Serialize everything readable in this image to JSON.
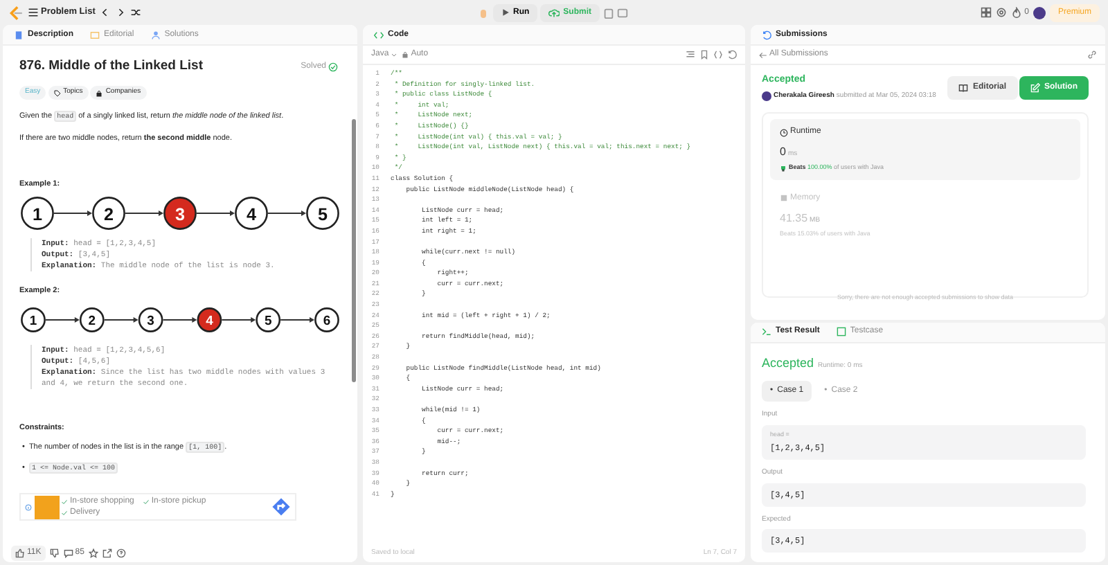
{
  "topbar": {
    "nav_label": "Problem List",
    "run_label": "Run",
    "submit_label": "Submit",
    "streak": "0",
    "premium": "Premium"
  },
  "description": {
    "tabs": [
      {
        "label": "Description",
        "selected": true
      },
      {
        "label": "Editorial",
        "selected": false
      },
      {
        "label": "Solutions",
        "selected": false
      }
    ],
    "title": "876. Middle of the Linked List",
    "status": "Solved",
    "tags": [
      {
        "label": "Easy",
        "kind": "difficulty"
      },
      {
        "label": "Topics",
        "kind": "topics"
      },
      {
        "label": "Companies",
        "kind": "companies"
      }
    ],
    "paragraphs": [
      [
        {
          "text": "Given the ",
          "kind": "text"
        },
        {
          "text": "head",
          "kind": "code"
        },
        {
          "text": " of a singly linked list, return ",
          "kind": "text"
        },
        {
          "text": "the middle node of the linked list",
          "kind": "italic"
        },
        {
          "text": ".",
          "kind": "text"
        }
      ],
      [
        {
          "text": "If there are two middle nodes, return ",
          "kind": "text"
        },
        {
          "text": "the second middle",
          "kind": "bold"
        },
        {
          "text": " node.",
          "kind": "text"
        }
      ]
    ],
    "examples": [
      {
        "title": "Example 1:",
        "nodes": [
          {
            "value": "1",
            "highlighted": false
          },
          {
            "value": "2",
            "highlighted": false
          },
          {
            "value": "3",
            "highlighted": true
          },
          {
            "value": "4",
            "highlighted": false
          },
          {
            "value": "5",
            "highlighted": false
          }
        ],
        "lines": [
          {
            "label": "Input:",
            "value": "head = [1,2,3,4,5]"
          },
          {
            "label": "Output:",
            "value": "[3,4,5]"
          },
          {
            "label": "Explanation:",
            "value": "The middle node of the list is node 3."
          }
        ]
      },
      {
        "title": "Example 2:",
        "nodes": [
          {
            "value": "1",
            "highlighted": false
          },
          {
            "value": "2",
            "highlighted": false
          },
          {
            "value": "3",
            "highlighted": false
          },
          {
            "value": "4",
            "highlighted": true
          },
          {
            "value": "5",
            "highlighted": false
          },
          {
            "value": "6",
            "highlighted": false
          }
        ],
        "lines": [
          {
            "label": "Input:",
            "value": "head = [1,2,3,4,5,6]"
          },
          {
            "label": "Output:",
            "value": "[4,5,6]"
          },
          {
            "label": "Explanation:",
            "value": "Since the list has two middle nodes with values 3 and 4, we return the second one."
          }
        ]
      }
    ],
    "constraints_title": "Constraints:",
    "bullet": "•",
    "constraints": [
      [
        {
          "text": "The number of nodes in the list is in the range ",
          "kind": "text"
        },
        {
          "text": "[1, 100]",
          "kind": "code"
        },
        {
          "text": ".",
          "kind": "text"
        }
      ],
      [
        {
          "text": "1 <= Node.val <= 100",
          "kind": "code"
        }
      ]
    ],
    "ad": {
      "features": [
        "In-store shopping",
        "In-store pickup",
        "Delivery"
      ]
    },
    "footer": {
      "likes": "11K",
      "comments": "85"
    }
  },
  "code": {
    "title": "Code",
    "language": "Java",
    "mode": "Auto",
    "lines": [
      {
        "n": "1",
        "text": "/**",
        "kind": "comment"
      },
      {
        "n": "2",
        "text": " * Definition for singly-linked list.",
        "kind": "comment"
      },
      {
        "n": "3",
        "text": " * public class ListNode {",
        "kind": "comment"
      },
      {
        "n": "4",
        "text": " *     int val;",
        "kind": "comment"
      },
      {
        "n": "5",
        "text": " *     ListNode next;",
        "kind": "comment"
      },
      {
        "n": "6",
        "text": " *     ListNode() {}",
        "kind": "comment"
      },
      {
        "n": "7",
        "text": " *     ListNode(int val) { this.val = val; }",
        "kind": "comment"
      },
      {
        "n": "8",
        "text": " *     ListNode(int val, ListNode next) { this.val = val; this.next = next; }",
        "kind": "comment"
      },
      {
        "n": "9",
        "text": " * }",
        "kind": "comment"
      },
      {
        "n": "10",
        "text": " */",
        "kind": "comment"
      },
      {
        "n": "11",
        "text": "class Solution {",
        "kind": "code"
      },
      {
        "n": "12",
        "text": "    public ListNode middleNode(ListNode head) {",
        "kind": "code"
      },
      {
        "n": "13",
        "kind": "code"
      },
      {
        "n": "14",
        "text": "        ListNode curr = head;",
        "kind": "code"
      },
      {
        "n": "15",
        "text": "        int left = 1;",
        "kind": "code"
      },
      {
        "n": "16",
        "text": "        int right = 1;",
        "kind": "code"
      },
      {
        "n": "17",
        "kind": "code"
      },
      {
        "n": "18",
        "text": "        while(curr.next != null)",
        "kind": "code"
      },
      {
        "n": "19",
        "text": "        {",
        "kind": "code"
      },
      {
        "n": "20",
        "text": "            right++;",
        "kind": "code"
      },
      {
        "n": "21",
        "text": "            curr = curr.next;",
        "kind": "code"
      },
      {
        "n": "22",
        "text": "        }",
        "kind": "code"
      },
      {
        "n": "23",
        "kind": "code"
      },
      {
        "n": "24",
        "text": "        int mid = (left + right + 1) / 2;",
        "kind": "code"
      },
      {
        "n": "25",
        "kind": "code"
      },
      {
        "n": "26",
        "text": "        return findMiddle(head, mid);",
        "kind": "code"
      },
      {
        "n": "27",
        "text": "    }",
        "kind": "code"
      },
      {
        "n": "28",
        "kind": "code"
      },
      {
        "n": "29",
        "text": "    public ListNode findMiddle(ListNode head, int mid)",
        "kind": "code"
      },
      {
        "n": "30",
        "text": "    {",
        "kind": "code"
      },
      {
        "n": "31",
        "text": "        ListNode curr = head;",
        "kind": "code"
      },
      {
        "n": "32",
        "kind": "code"
      },
      {
        "n": "33",
        "text": "        while(mid != 1)",
        "kind": "code"
      },
      {
        "n": "34",
        "text": "        {",
        "kind": "code"
      },
      {
        "n": "35",
        "text": "            curr = curr.next;",
        "kind": "code"
      },
      {
        "n": "36",
        "text": "            mid--;",
        "kind": "code"
      },
      {
        "n": "37",
        "text": "        }",
        "kind": "code"
      },
      {
        "n": "38",
        "kind": "code"
      },
      {
        "n": "39",
        "text": "        return curr;",
        "kind": "code"
      },
      {
        "n": "40",
        "text": "    }",
        "kind": "code"
      },
      {
        "n": "41",
        "text": "}",
        "kind": "code"
      }
    ],
    "saved": "Saved to local",
    "cursor": "Ln 7, Col 7"
  },
  "submission": {
    "title": "Submissions",
    "back": "All Submissions",
    "status": "Accepted",
    "author": "Cherakala Gireesh",
    "submitted": "submitted at Mar 05, 2024 03:18",
    "editorial_button": "Editorial",
    "solution_button": "Solution",
    "metrics": [
      {
        "label": "Runtime",
        "value": "0",
        "unit": "ms",
        "beats_label": "Beats",
        "beats": "100.00%",
        "beats_rest": "of users with Java",
        "selected": true
      },
      {
        "label": "Memory",
        "value": "41.35",
        "unit": "MB",
        "beats_label": "Beats",
        "beats": "15.03%",
        "beats_rest": "of users with Java",
        "selected": false
      }
    ],
    "no_data": "Sorry, there are not enough accepted submissions to show data"
  },
  "result": {
    "tabs": [
      {
        "label": "Test Result",
        "selected": true
      },
      {
        "label": "Testcase",
        "selected": false
      }
    ],
    "status": "Accepted",
    "runtime": "Runtime: 0 ms",
    "case_bullet": "•",
    "cases": [
      {
        "label": "Case 1",
        "selected": true
      },
      {
        "label": "Case 2",
        "selected": false
      }
    ],
    "input_label": "Input",
    "input_name": "head =",
    "input_value": "[1,2,3,4,5]",
    "output_label": "Output",
    "output_value": "[3,4,5]",
    "expected_label": "Expected",
    "expected_value": "[3,4,5]"
  }
}
